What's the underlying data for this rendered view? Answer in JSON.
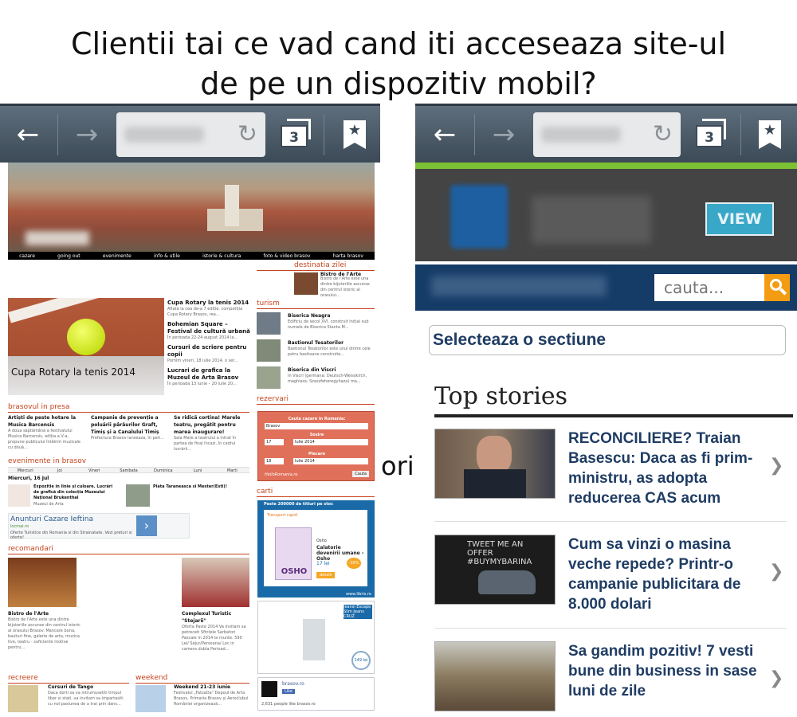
{
  "headline": {
    "line1": "Clientii tai ce vad cand iti acceseaza site-ul",
    "line2": "de pe un dispozitiv mobil?"
  },
  "separator_word": "ori",
  "browser": {
    "tab_count": "3",
    "back_icon": "arrow-left-icon",
    "forward_icon": "arrow-right-icon",
    "reload_icon": "reload-icon",
    "bookmark_icon": "bookmark-star-icon"
  },
  "left_site": {
    "nav": [
      "cazare",
      "going out",
      "evenimente",
      "info & utile",
      "istorie & cultura",
      "foto & video brasov",
      "harta brasov"
    ],
    "destinatia_zilei": {
      "title": "destinatia zilei",
      "item_title": "Bistro de l'Arte",
      "item_text": "Bistro de l'Arte este una dintre bijuteriile ascunse din centrul istoric al orasului..."
    },
    "hero_caption": "Cupa Rotary la tenis 2014",
    "news": [
      {
        "title": "Cupa Rotary la tenis 2014",
        "text": "Aflată la cea de-a 7 ediție, competiția Cupa Rotary Brașov, rea..."
      },
      {
        "title": "Bohemian Square – Festival de cultură urbană",
        "text": "În perioada 22-24 august 2014 la..."
      },
      {
        "title": "Cursuri de scriere pentru copii",
        "text": "Pornim vineri, 18 iulie 2014, o ser..."
      },
      {
        "title": "Lucrari de grafica la Muzeul de Arta Brasov",
        "text": "În perioada 13 iunie – 20 iulie 20..."
      }
    ],
    "turism": {
      "title": "turism",
      "items": [
        {
          "title": "Biserica Neagra",
          "text": "Edificiu de secol XVI, construit inițial sub numele de Biserica Stanta M..."
        },
        {
          "title": "Bastionul Tesatorilor",
          "text": "Bastionul Tesatorilor este unul dintre cele patru bastioane construite..."
        },
        {
          "title": "Biserica din Viscri",
          "text": "In Viscri (germana: Deutsch-Weisskirch, maghiara: Szaszfeheregyhaza) ma..."
        }
      ]
    },
    "brasovul_in_presa": {
      "title": "brasovul in presa",
      "items": [
        {
          "title": "Artiști de peste hotare la Musica Barcensis",
          "text": "A doua săptămână a festivalului Musica Barcensis, ediția a V-a, propune publicului întâlniri muzicale cu douã..."
        },
        {
          "title": "Campanie de prevenție a poluării pârâurilor Graft, Timiș și a Canalului Timiș",
          "text": "Prefectura Brasov lanseaza, în peri..."
        },
        {
          "title": "Se ridică cortina! Marele teatru, pregătit pentru marea inaugurare!",
          "text": "Sala Mare a teatrului a intrat în partea de final încazi, în cadrul lucrării..."
        }
      ]
    },
    "rezervari": {
      "title": "rezervari",
      "heading": "Cauta cazare in Romania:",
      "city": "Brasov",
      "sosire_label": "Sosire",
      "sosire_day": "17",
      "sosire_month": "Iulie 2014",
      "plecare_label": "Plecare",
      "plecare_day": "18",
      "plecare_month": "Iulie 2014",
      "button": "Cauta",
      "brand": "HelloRomania.ro"
    },
    "evenimente": {
      "title": "evenimente in brasov",
      "days": [
        "Miercuri",
        "Joi",
        "Vineri",
        "Sambata",
        "Duminica",
        "Luni",
        "Marti"
      ],
      "date": "Miercuri, 16 Jul",
      "items": [
        {
          "title": "Expozitie in linie și culoare. Lucrări de grafică din colecția Muzeului Național Brukenthal",
          "place": "Muzeul de Arta"
        },
        {
          "title": "Piata Taraneasca si Mester(Esti)!",
          "place": ""
        }
      ]
    },
    "ad": {
      "title": "Anunturi Cazare Ieftina",
      "url": "locmai.ro",
      "text": "Oferte Turistice din Romania si din Strainatate. Vezi preturi si oferte!"
    },
    "carti": {
      "title": "carti",
      "banner": "Peste 200000 de titluri pe stoc",
      "transport": "Transport rapid",
      "author": "Osho",
      "book_title": "Calatorie devenirii umane - Osho",
      "price": "17 lei",
      "discount": "-30%",
      "cta": "detalii",
      "site": "www.libris.ro",
      "brand": "OSHO"
    },
    "jeans_ad": {
      "label": "Jeansi Escape Slim Jeans CRUZ",
      "price": "149 lei"
    },
    "fb": {
      "name": "brasov.ro",
      "like": "Like",
      "count": "2,631 people like brasov.ro"
    },
    "recomandari": {
      "title": "recomandari",
      "items": [
        {
          "title": "Bistro de l'Arte",
          "text": "Bistro de l'Arte este una dintre bijuteriile ascunse din centrul istoric al orasului Brasov. Mancare buna, bauturi fine, galerie de arta, muzica live, teatru - suficiente motive pentru..."
        },
        {
          "title": "Complexul Turistic \"Stejarii\"",
          "text": "Oferta Paste 2014 Va invitam sa petreceti Sfintele Sarbatori Pascale in 2014 la munte. 590 Lei/ Sejur/Persoana/ Loc in camera dubla Perioad..."
        }
      ]
    },
    "recreere": {
      "title": "recreere",
      "item_title": "Cursuri de Tango",
      "item_text": "Daca dorti sa va intrumusetiti timpul liber si stati, va invitam sa impartasiti cu noi pasiunea de a trai prin dans..."
    },
    "weekend": {
      "title": "weekend",
      "item_title": "Weekend 21-23 iunie",
      "item_text": "Festivalul „FatzaDa\" Depoul de Arta Brasov, Primaria Brasov și Aeroclubul României organizează..."
    }
  },
  "right_site": {
    "view_button": "VIEW",
    "search_placeholder": "cauta...",
    "section_select": "Selecteaza o sectiune",
    "top_stories_title": "Top stories",
    "stories": [
      {
        "title": "RECONCILIERE? Traian Basescu: Daca as fi prim-ministru, as adopta reducerea CAS acum"
      },
      {
        "title": "Cum sa vinzi o masina veche repede? Printr-o campanie publicitara de 8.000 dolari",
        "image_text": "TWEET ME AN OFFER #BUYMYBARINA"
      },
      {
        "title": "Sa gandim pozitiv! 7 vesti bune din business in sase luni de zile"
      }
    ],
    "chevron_icon": "chevron-right-icon"
  },
  "colors": {
    "toolbar": "#4a5866",
    "section_red": "#c6431c",
    "story_title": "#1f3c63",
    "search_orange": "#f39c12",
    "view_blue": "#39a8c8"
  }
}
